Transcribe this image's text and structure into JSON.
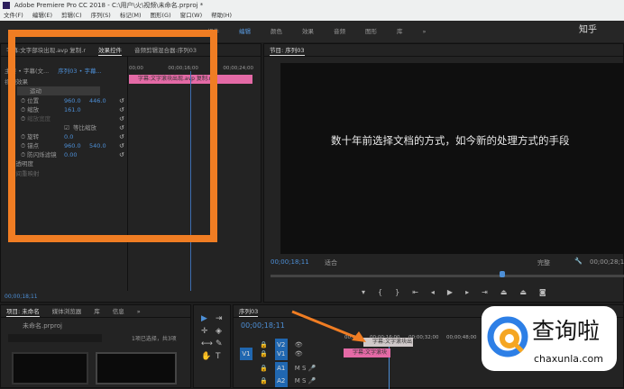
{
  "window": {
    "title": "Adobe Premiere Pro CC 2018 - C:\\用户\\火\\视频\\未命名.prproj *"
  },
  "menu": [
    "文件(F)",
    "编辑(E)",
    "剪辑(C)",
    "序列(S)",
    "标记(M)",
    "图形(G)",
    "窗口(W)",
    "帮助(H)"
  ],
  "workspaces": [
    "组件",
    "编辑",
    "颜色",
    "效果",
    "音频",
    "图形",
    "库",
    "»"
  ],
  "corner_watermark": "知乎",
  "effect_controls": {
    "tabs": [
      "字幕:文字部块出现.avp 复制.r",
      "效果控件",
      "音频剪辑混合器:序列03"
    ],
    "source": "主要 • 字幕(文...",
    "sequence": "序列03 • 字幕...",
    "ruler": [
      "00;00",
      "00;00;16;00",
      "00;00;24;00"
    ],
    "clip_label": "字幕:文字滚块出现.avp 复制.r",
    "section": "视频效果",
    "motion": "运动",
    "props": [
      {
        "name": "位置",
        "v1": "960.0",
        "v2": "446.0"
      },
      {
        "name": "缩放",
        "v1": "161.0",
        "v2": ""
      },
      {
        "name": "缩放宽度",
        "v1": "",
        "v2": "",
        "disabled": true
      },
      {
        "name": "等比缩放",
        "checkbox": true
      },
      {
        "name": "旋转",
        "v1": "0.0",
        "v2": ""
      },
      {
        "name": "锚点",
        "v1": "960.0",
        "v2": "540.0"
      },
      {
        "name": "防闪烁滤镜",
        "v1": "0.00",
        "v2": ""
      }
    ],
    "opacity": "不透明度",
    "time_remap": "时间重映射",
    "timecode": "00;00;18;11"
  },
  "program": {
    "title": "节目: 序列03",
    "subtitle": "数十年前选择文档的方式，如今新的处理方式的手段",
    "timecode": "00;00;18;11",
    "fit": "适合",
    "quality": "完整",
    "duration": "00;00;28;1",
    "controls": [
      "marker",
      "mark-in",
      "mark-out",
      "go-to-in",
      "step-back",
      "play",
      "step-forward",
      "go-to-out",
      "lift",
      "extract",
      "export-frame"
    ]
  },
  "project": {
    "tabs": [
      "项目: 未命名",
      "媒体浏览器",
      "库",
      "信息",
      "»"
    ],
    "file": "未命名.prproj",
    "selection": "1项已选择，共3项",
    "search_placeholder": ""
  },
  "timeline": {
    "title": "序列03",
    "timecode": "00;00;18;11",
    "ruler": [
      "00;00",
      "00;00;16;00",
      "00;00;32;00",
      "00;00;48;00"
    ],
    "tracks": [
      "V2",
      "V1",
      "A1",
      "A2"
    ],
    "source_track": [
      "V1",
      "A1"
    ],
    "clips": [
      {
        "track": "V2",
        "label": "字幕:文字滚块出现"
      },
      {
        "track": "V1",
        "label": "字幕:文字滚块"
      }
    ]
  },
  "watermark": {
    "name": "查询啦",
    "url": "chaxunla.com"
  }
}
